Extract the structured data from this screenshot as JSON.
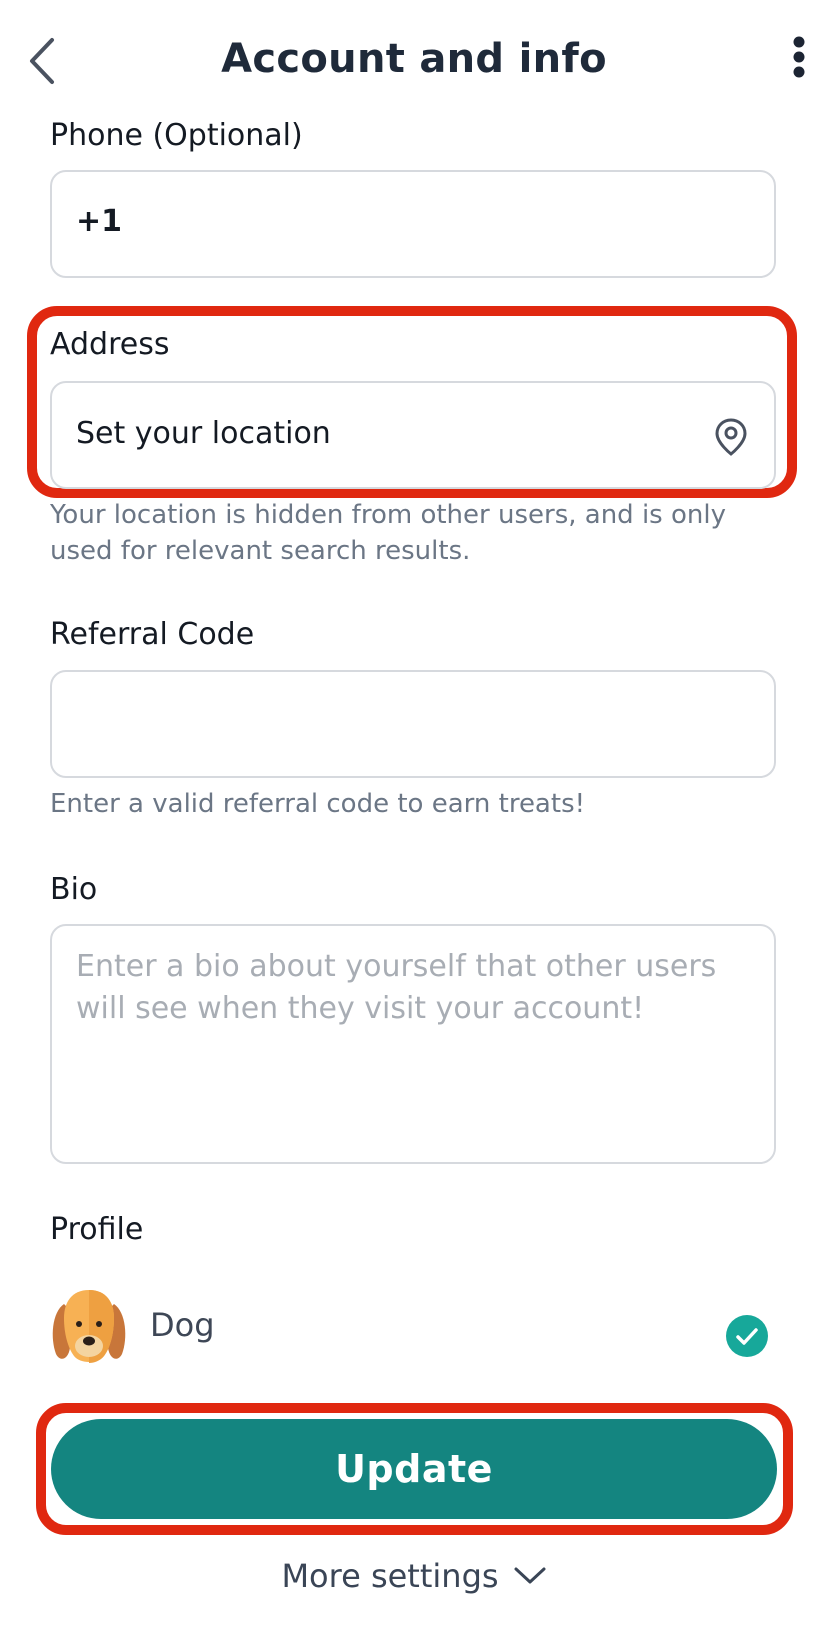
{
  "header": {
    "title": "Account and info"
  },
  "phone": {
    "label": "Phone (Optional)",
    "value": "+1"
  },
  "address": {
    "label": "Address",
    "value": "Set your location",
    "helper": "Your location is hidden from other users, and is only used for relevant search results."
  },
  "referral": {
    "label": "Referral Code",
    "value": "",
    "helper": "Enter a valid referral code to earn treats!"
  },
  "bio": {
    "label": "Bio",
    "placeholder": "Enter a bio about yourself that other users will see when they visit your account!"
  },
  "profile": {
    "label": "Profile",
    "items": [
      {
        "name": "Dog",
        "selected": true
      }
    ]
  },
  "actions": {
    "update_label": "Update",
    "more_settings_label": "More settings"
  },
  "colors": {
    "accent": "#148580",
    "check": "#17a89a",
    "highlight": "#e02810"
  }
}
